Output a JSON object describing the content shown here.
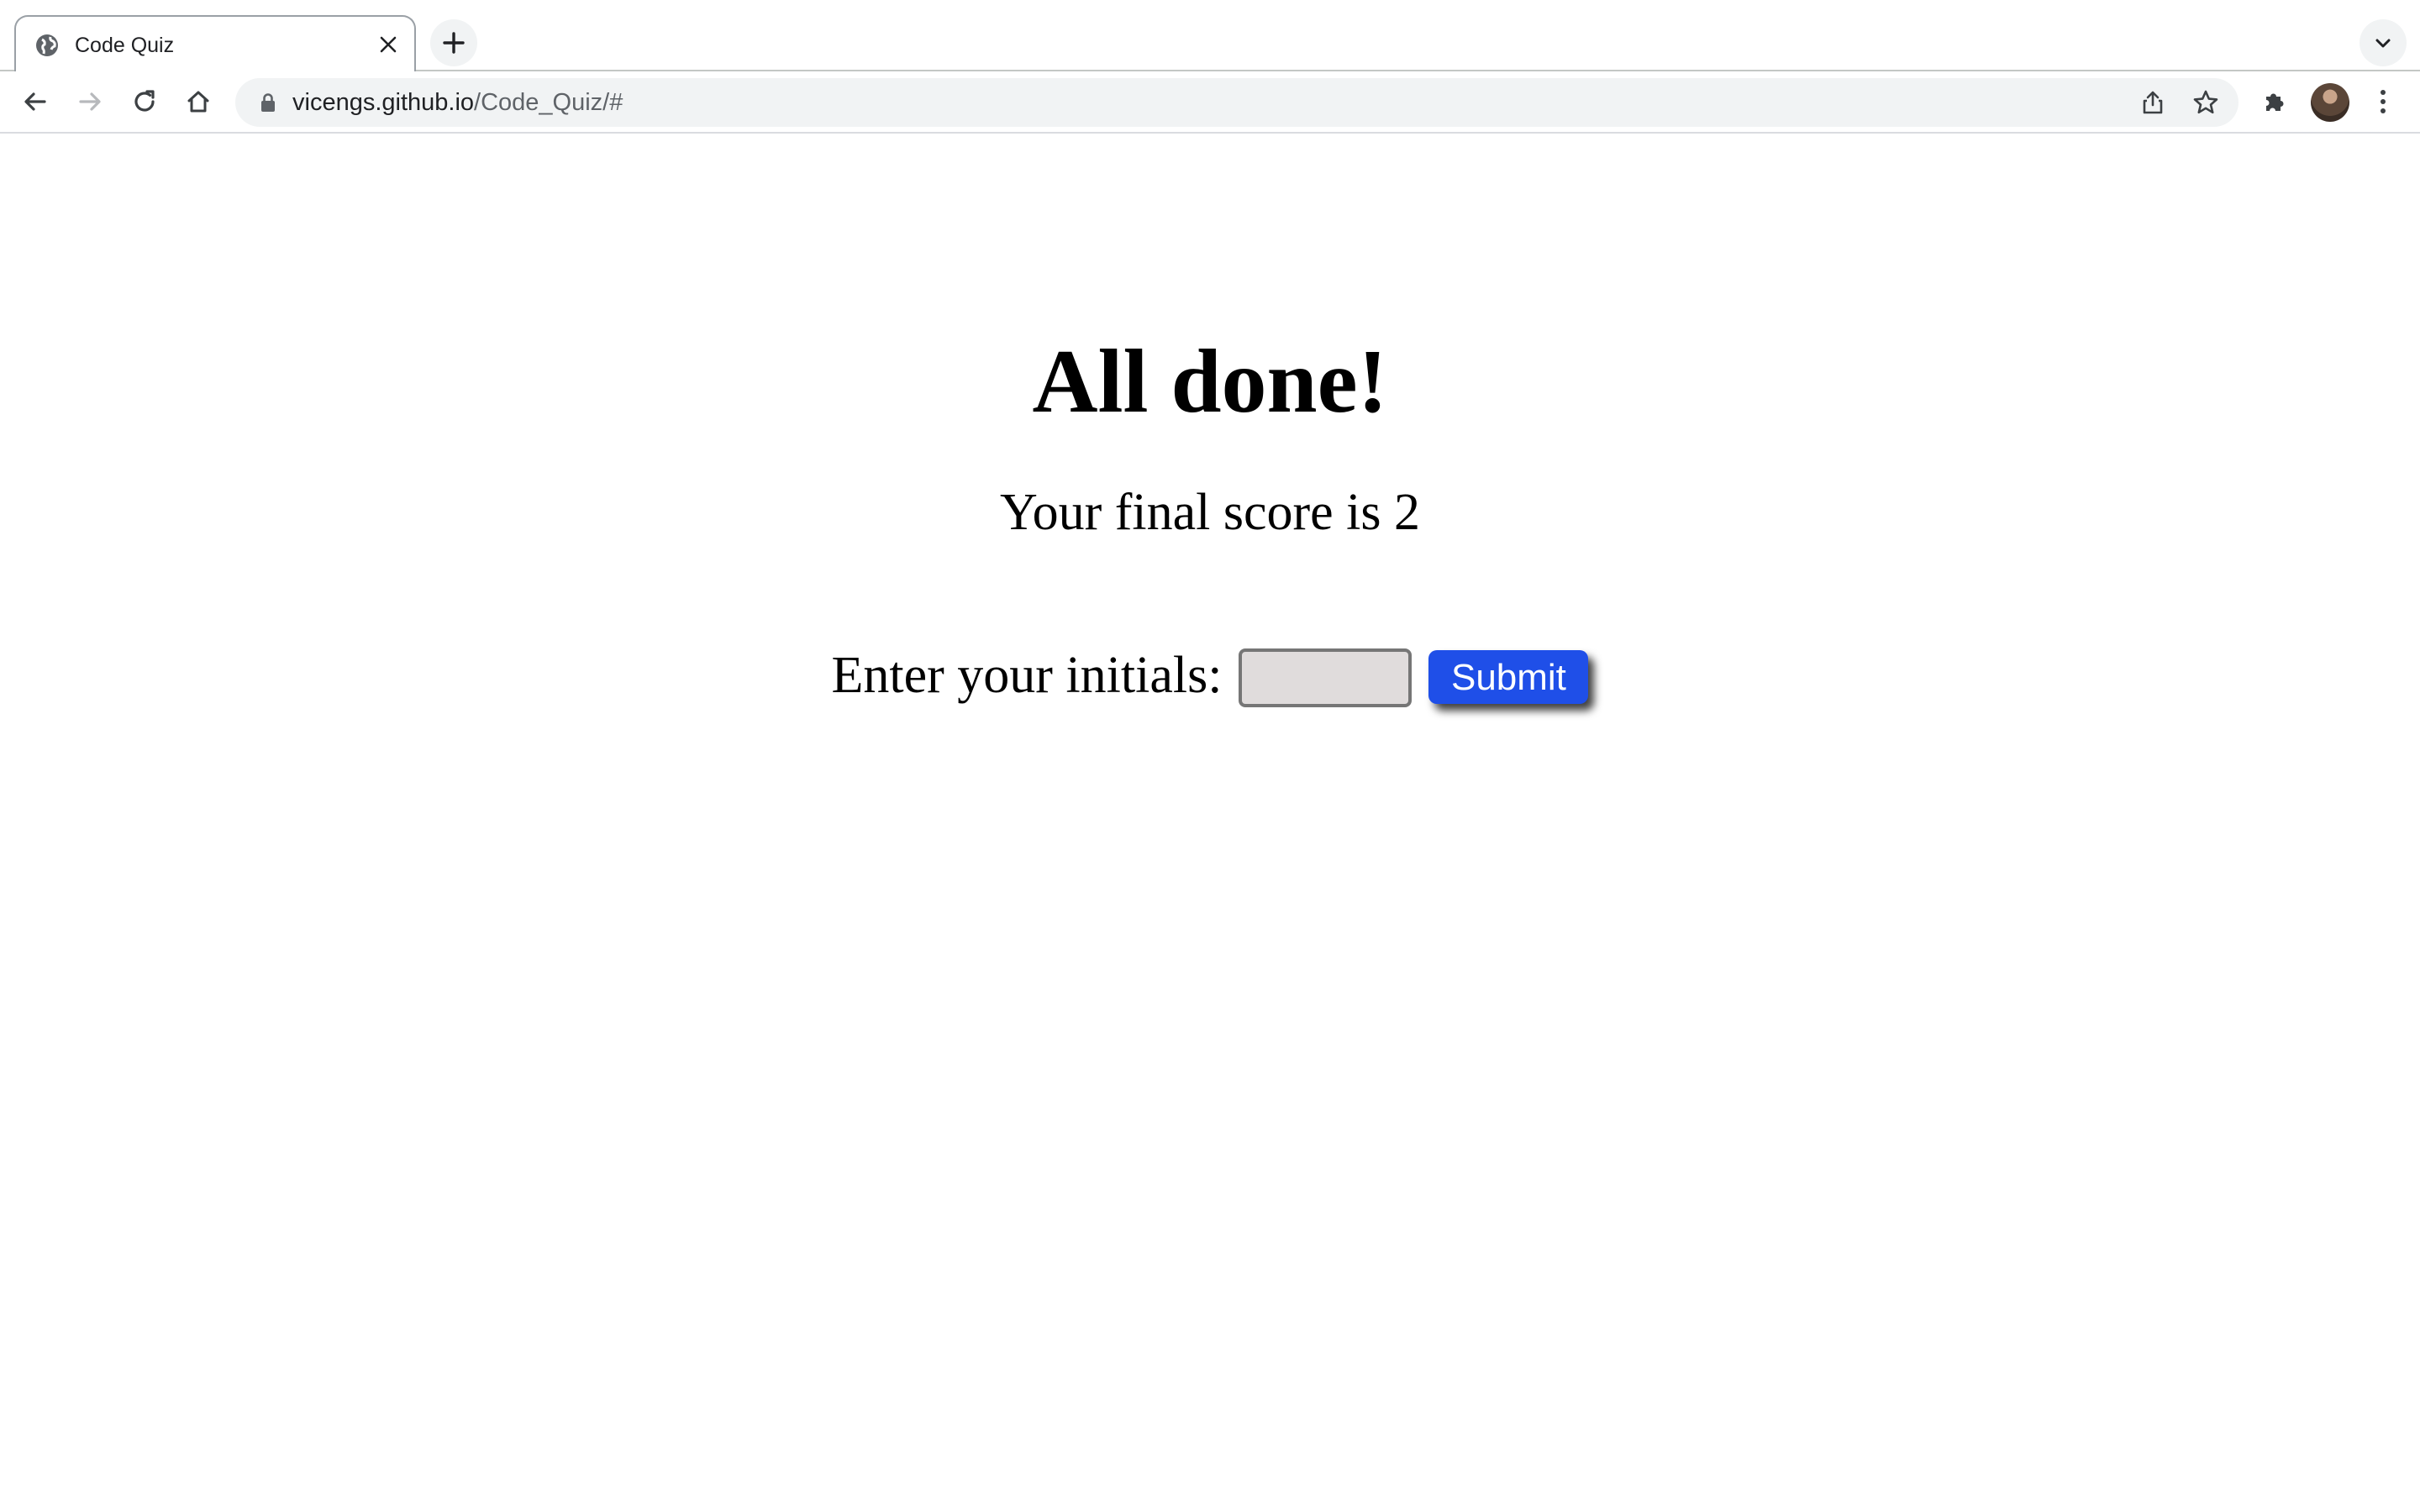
{
  "browser": {
    "tab": {
      "title": "Code Quiz",
      "favicon": "globe-icon"
    },
    "toolbar": {
      "url_host": "vicengs.github.io",
      "url_path": "/Code_Quiz/#"
    },
    "icons": {
      "tab_close": "close-icon",
      "new_tab": "plus-icon",
      "tab_search": "chevron-down-icon",
      "back": "back-arrow-icon",
      "forward": "forward-arrow-icon",
      "reload": "reload-icon",
      "home": "home-icon",
      "lock": "lock-icon",
      "share": "share-icon",
      "bookmark": "star-icon",
      "extensions": "puzzle-icon",
      "menu": "kebab-menu-icon"
    }
  },
  "quiz": {
    "heading": "All done!",
    "score_text": "Your final score is 2",
    "initials_label": "Enter your initials:",
    "initials_value": "",
    "submit_label": "Submit"
  },
  "colors": {
    "submit_button": "#1f4fe8",
    "input_background": "#e0dcdc"
  }
}
